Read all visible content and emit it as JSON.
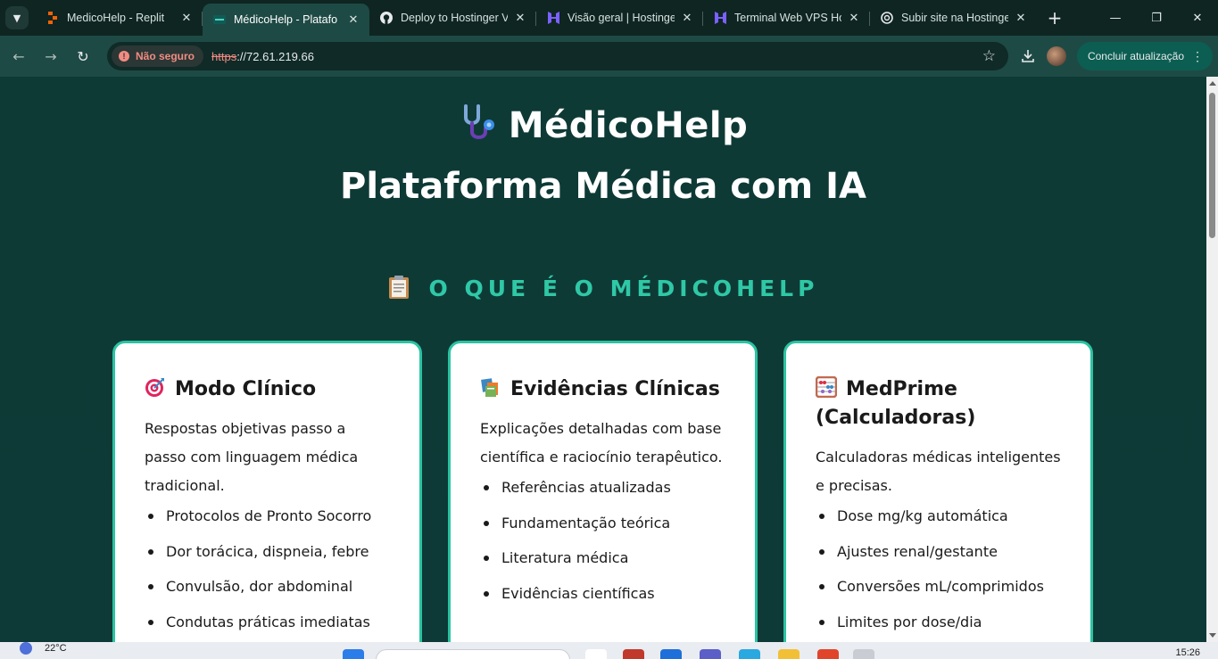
{
  "browser": {
    "tabs": [
      {
        "title": "MedicoHelp - Replit",
        "favicon": "replit-icon",
        "active": false
      },
      {
        "title": "MédicoHelp - Platafo",
        "favicon": "site-icon",
        "active": true
      },
      {
        "title": "Deploy to Hostinger V",
        "favicon": "github-icon",
        "active": false
      },
      {
        "title": "Visão geral | Hostinge",
        "favicon": "hostinger-icon",
        "active": false
      },
      {
        "title": "Terminal Web VPS Ho",
        "favicon": "hostinger-icon",
        "active": false
      },
      {
        "title": "Subir site na Hostinge",
        "favicon": "chatgpt-icon",
        "active": false
      }
    ],
    "security_label": "Não seguro",
    "url_scheme": "https",
    "url_rest": "://72.61.219.66",
    "update_label": "Concluir atualização"
  },
  "page": {
    "brand_title": "MédicoHelp",
    "subtitle": "Plataforma Médica com IA",
    "section_title": "O QUE É O MÉDICOHELP",
    "cards": [
      {
        "icon": "target-icon",
        "title": "Modo Clínico",
        "description": "Respostas objetivas passo a passo com linguagem médica tradicional.",
        "items": [
          "Protocolos de Pronto Socorro",
          "Dor torácica, dispneia, febre",
          "Convulsão, dor abdominal",
          "Condutas práticas imediatas"
        ]
      },
      {
        "icon": "books-icon",
        "title": "Evidências Clínicas",
        "description": "Explicações detalhadas com base científica e raciocínio terapêutico.",
        "items": [
          "Referências atualizadas",
          "Fundamentação teórica",
          "Literatura médica",
          "Evidências científicas"
        ]
      },
      {
        "icon": "abacus-icon",
        "title": "MedPrime (Calculadoras)",
        "description": "Calculadoras médicas inteligentes e precisas.",
        "items": [
          "Dose mg/kg automática",
          "Ajustes renal/gestante",
          "Conversões mL/comprimidos",
          "Limites por dose/dia"
        ]
      }
    ]
  },
  "taskbar": {
    "temperature": "22°C",
    "time": "15:26"
  }
}
